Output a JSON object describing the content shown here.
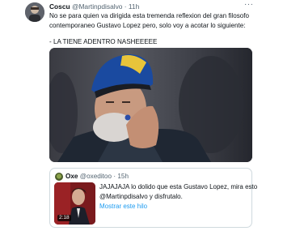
{
  "tweet": {
    "name": "Coscu",
    "handle": "@Martinpdisalvo",
    "separator": "·",
    "time": "11h",
    "more": "···",
    "lines": [
      "No se para quien va dirigida esta tremenda reflexion del gran filosofo",
      "contemporaneo Gustavo Lopez pero, solo voy a acotar lo siguiente:",
      "- LA TIENE ADENTRO NASHEEEEE"
    ]
  },
  "quote": {
    "name": "Oxe",
    "handle": "@oxeditoo",
    "separator": "·",
    "time": "15h",
    "lines": [
      "JAJAJAJA lo dolido que esta Gustavo Lopez, mira esto",
      "@Martinpdisalvo y disfrutalo."
    ],
    "link": "Mostrar este hilo",
    "video_duration": "2:18"
  },
  "icons": {
    "avatar": "user-avatar",
    "more": "more-options-icon",
    "quote_avatar": "quote-user-avatar"
  },
  "colors": {
    "link": "#1d9bf0",
    "secondary_text": "#536471",
    "border": "#cfd9de"
  }
}
